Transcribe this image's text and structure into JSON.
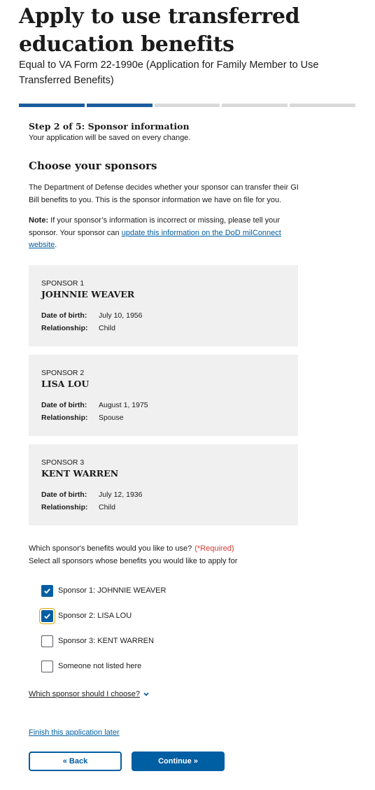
{
  "page": {
    "title": "Apply to use transferred education benefits",
    "subtitle": "Equal to VA Form 22-1990e (Application for Family Member to Use Transferred Benefits)"
  },
  "progress": {
    "total_steps": 5,
    "current_step": 2
  },
  "step": {
    "title": "Step 2 of 5: Sponsor information",
    "save_note": "Your application will be saved on every change."
  },
  "section": {
    "title": "Choose your sponsors",
    "intro": "The Department of Defense decides whether your sponsor can transfer their GI Bill benefits to you. This is the sponsor information we have on file for you.",
    "note_label": "Note:",
    "note_text": " If your sponsor’s information is incorrect or missing, please tell your sponsor. Your sponsor can ",
    "note_link": "update this information on the DoD milConnect website",
    "note_end": "."
  },
  "sponsors": [
    {
      "number_label": "SPONSOR 1",
      "name": "JOHNNIE WEAVER",
      "dob_label": "Date of birth:",
      "dob": "July 10, 1956",
      "relationship_label": "Relationship:",
      "relationship": "Child"
    },
    {
      "number_label": "SPONSOR 2",
      "name": "LISA LOU",
      "dob_label": "Date of birth:",
      "dob": "August 1, 1975",
      "relationship_label": "Relationship:",
      "relationship": "Spouse"
    },
    {
      "number_label": "SPONSOR 3",
      "name": "KENT WARREN",
      "dob_label": "Date of birth:",
      "dob": "July 12, 1936",
      "relationship_label": "Relationship:",
      "relationship": "Child"
    }
  ],
  "question": {
    "label": "Which sponsor's benefits would you like to use?",
    "required": "(*Required)",
    "hint": "Select all sponsors whose benefits you would like to apply for"
  },
  "options": [
    {
      "label": "Sponsor 1: JOHNNIE WEAVER",
      "checked": true
    },
    {
      "label": "Sponsor 2: LISA LOU",
      "checked": true
    },
    {
      "label": "Sponsor 3: KENT WARREN",
      "checked": false
    },
    {
      "label": "Someone not listed here",
      "checked": false
    }
  ],
  "expander": {
    "label": "Which sponsor should I choose?",
    "icon": "chevron-down-icon"
  },
  "footer": {
    "finish_later": "Finish this application later",
    "back_label": "« Back",
    "continue_label": "Continue »"
  },
  "colors": {
    "primary": "#005ea2",
    "progress_done": "#1a5c9e",
    "progress_todo": "#d9d9d9",
    "card_bg": "#f0f0f0",
    "required": "#d83933"
  }
}
